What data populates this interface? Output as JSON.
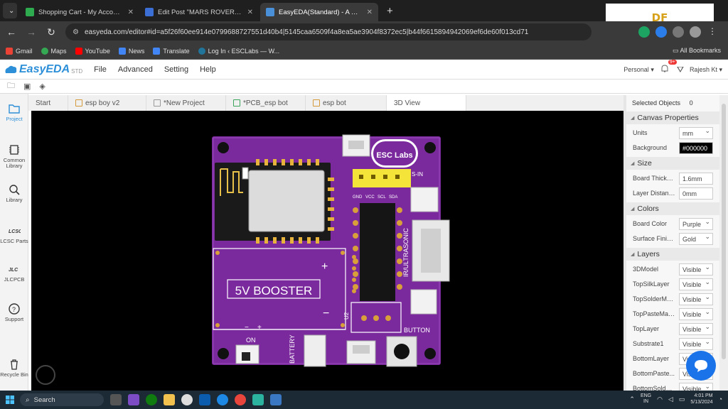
{
  "browser": {
    "tabs": [
      {
        "title": "Shopping Cart - My Account - PC",
        "fav_color": "#2eaa4f",
        "active": false
      },
      {
        "title": "Edit Post \"MARS ROVER USING N",
        "fav_color": "#3b6fd6",
        "active": false
      },
      {
        "title": "EasyEDA(Standard) - A Simple and",
        "fav_color": "#4a90d9",
        "active": true
      }
    ],
    "new_tab_symbol": "+",
    "corner_badge": "DF",
    "url": "easyeda.com/editor#id=a5f26f60ee914e0799688727551d40b4|5145caa6509f4a8ea5ae3904f8372ec5|b44f6615894942069ef6de60f013cd71",
    "bookmarks": [
      {
        "label": "Gmail",
        "color": "#ea4335"
      },
      {
        "label": "Maps",
        "color": "#34a853"
      },
      {
        "label": "YouTube",
        "color": "#ff0000"
      },
      {
        "label": "News",
        "color": "#4285f4"
      },
      {
        "label": "Translate",
        "color": "#4285f4"
      },
      {
        "label": "Log In ‹ ESCLabs — W...",
        "color": "#21759b"
      }
    ],
    "all_bookmarks": "All Bookmarks"
  },
  "app": {
    "logo_text": "EasyEDA",
    "logo_suffix": "STD",
    "menu": [
      "File",
      "Advanced",
      "Setting",
      "Help"
    ],
    "account_type": "Personal",
    "notification_count": "9+",
    "user_name": "Rajesh Kt"
  },
  "left_panel": [
    {
      "label": "Project",
      "icon": "folder-icon",
      "active": true
    },
    {
      "label": "Common Library",
      "icon": "common-library-icon",
      "active": false
    },
    {
      "label": "Library",
      "icon": "library-search-icon",
      "active": false
    },
    {
      "label": "LCSC Parts",
      "icon": "lcsc-icon",
      "active": false
    },
    {
      "label": "JLCPCB",
      "icon": "jlcpcb-icon",
      "active": false
    },
    {
      "label": "Support",
      "icon": "support-icon",
      "active": false
    },
    {
      "label": "Recycle Bin",
      "icon": "trash-icon",
      "active": false
    }
  ],
  "doc_tabs": [
    {
      "label": "Start",
      "active": false
    },
    {
      "label": "esp boy v2",
      "active": false
    },
    {
      "label": "*New Project",
      "active": false
    },
    {
      "label": "*PCB_esp bot",
      "active": false
    },
    {
      "label": "esp bot",
      "active": false
    },
    {
      "label": "3D View",
      "active": true
    }
  ],
  "pcb": {
    "logo": "ESC Labs",
    "booster_label": "5V BOOSTER",
    "pin_labels": [
      "GND",
      "VCC",
      "SCL",
      "SDA"
    ],
    "header_label": "S-IN",
    "ultrasonic_label": "IR/ULTRASONIC",
    "button_label": "BUTTON",
    "battery_label": "BATTERY",
    "on_label": "ON",
    "plus": "+",
    "minus": "−",
    "booster_ref": "U2",
    "board_color": "#7b2a9e"
  },
  "properties": {
    "selected_objects_label": "Selected Objects",
    "selected_objects_count": "0",
    "canvas_properties": "Canvas Properties",
    "units_label": "Units",
    "units_value": "mm",
    "background_label": "Background",
    "background_value": "#000000",
    "size_section": "Size",
    "board_thickness_label": "Board Thickn...",
    "board_thickness_value": "1.6mm",
    "layer_distance_label": "Layer Distance",
    "layer_distance_value": "0mm",
    "colors_section": "Colors",
    "board_color_label": "Board Color",
    "board_color_value": "Purple",
    "surface_finish_label": "Surface Finis...",
    "surface_finish_value": "Gold",
    "layers_section": "Layers",
    "layers": [
      {
        "name": "3DModel",
        "value": "Visible"
      },
      {
        "name": "TopSilkLayer",
        "value": "Visible"
      },
      {
        "name": "TopSolderMa...",
        "value": "Visible"
      },
      {
        "name": "TopPasteMas...",
        "value": "Visible"
      },
      {
        "name": "TopLayer",
        "value": "Visible"
      },
      {
        "name": "Substrate1",
        "value": "Visible"
      },
      {
        "name": "BottomLayer",
        "value": "Visible"
      },
      {
        "name": "BottomPaste...",
        "value": "Visible"
      },
      {
        "name": "BottomSolder...",
        "value": "Visible"
      }
    ]
  },
  "taskbar": {
    "search_placeholder": "Search",
    "lang_top": "ENG",
    "lang_bottom": "IN",
    "time": "4:01 PM",
    "date": "5/13/2024"
  }
}
